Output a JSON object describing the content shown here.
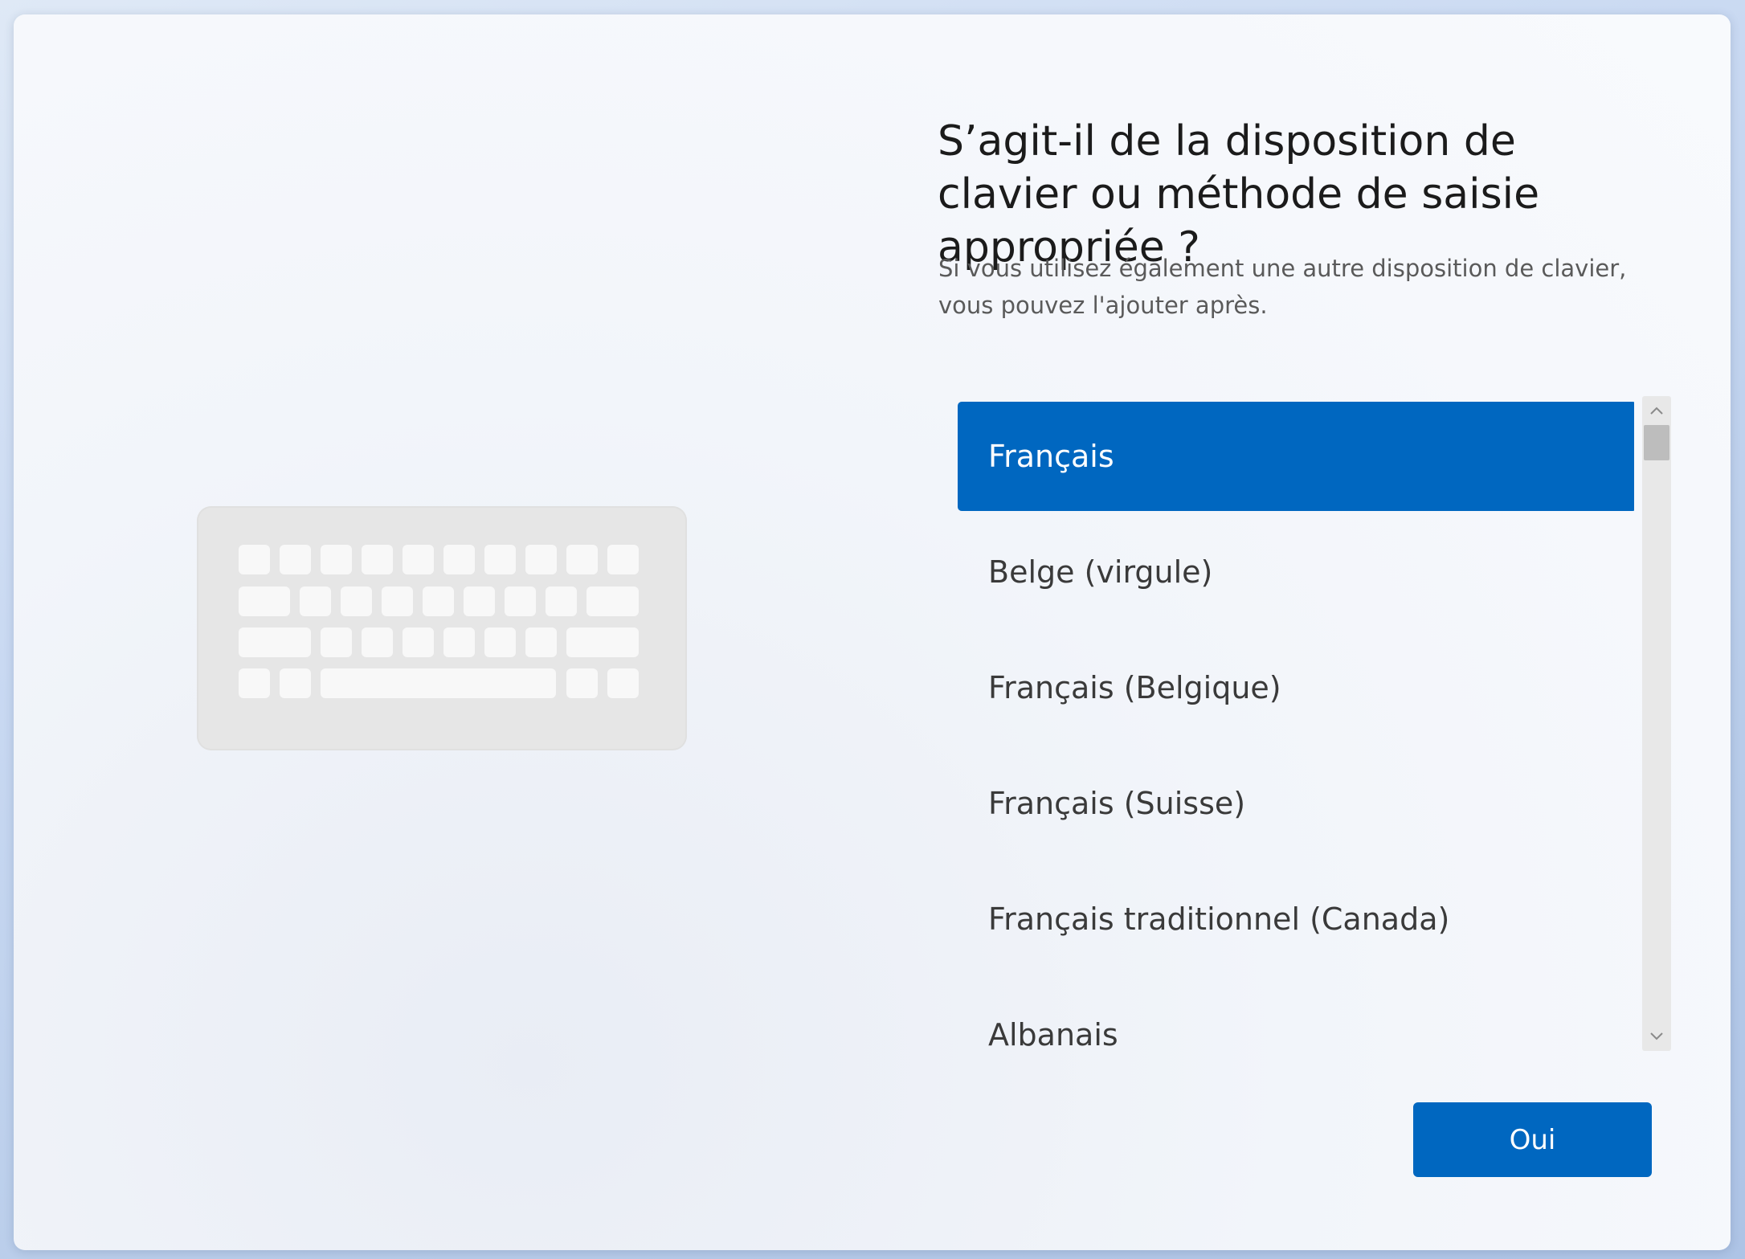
{
  "header": {
    "title": "S’agit-il de la disposition de clavier ou méthode de saisie appropriée ?",
    "subtitle": "Si vous utilisez également une autre disposition de clavier, vous pouvez l'ajouter après."
  },
  "keyboard_list": {
    "selected_index": 0,
    "items": [
      {
        "label": "Français"
      },
      {
        "label": "Belge (virgule)"
      },
      {
        "label": "Français (Belgique)"
      },
      {
        "label": "Français (Suisse)"
      },
      {
        "label": "Français traditionnel (Canada)"
      },
      {
        "label": "Albanais"
      }
    ]
  },
  "icons": {
    "illustration": "keyboard-icon",
    "scroll_up": "chevron-up-icon",
    "scroll_down": "chevron-down-icon"
  },
  "actions": {
    "confirm_label": "Oui"
  },
  "colors": {
    "accent": "#0067c0",
    "text_primary": "#1b1b1b",
    "text_secondary": "#5a5a5a",
    "keyboard_body": "#e6e6e6",
    "keyboard_key": "#f8f8f8"
  }
}
